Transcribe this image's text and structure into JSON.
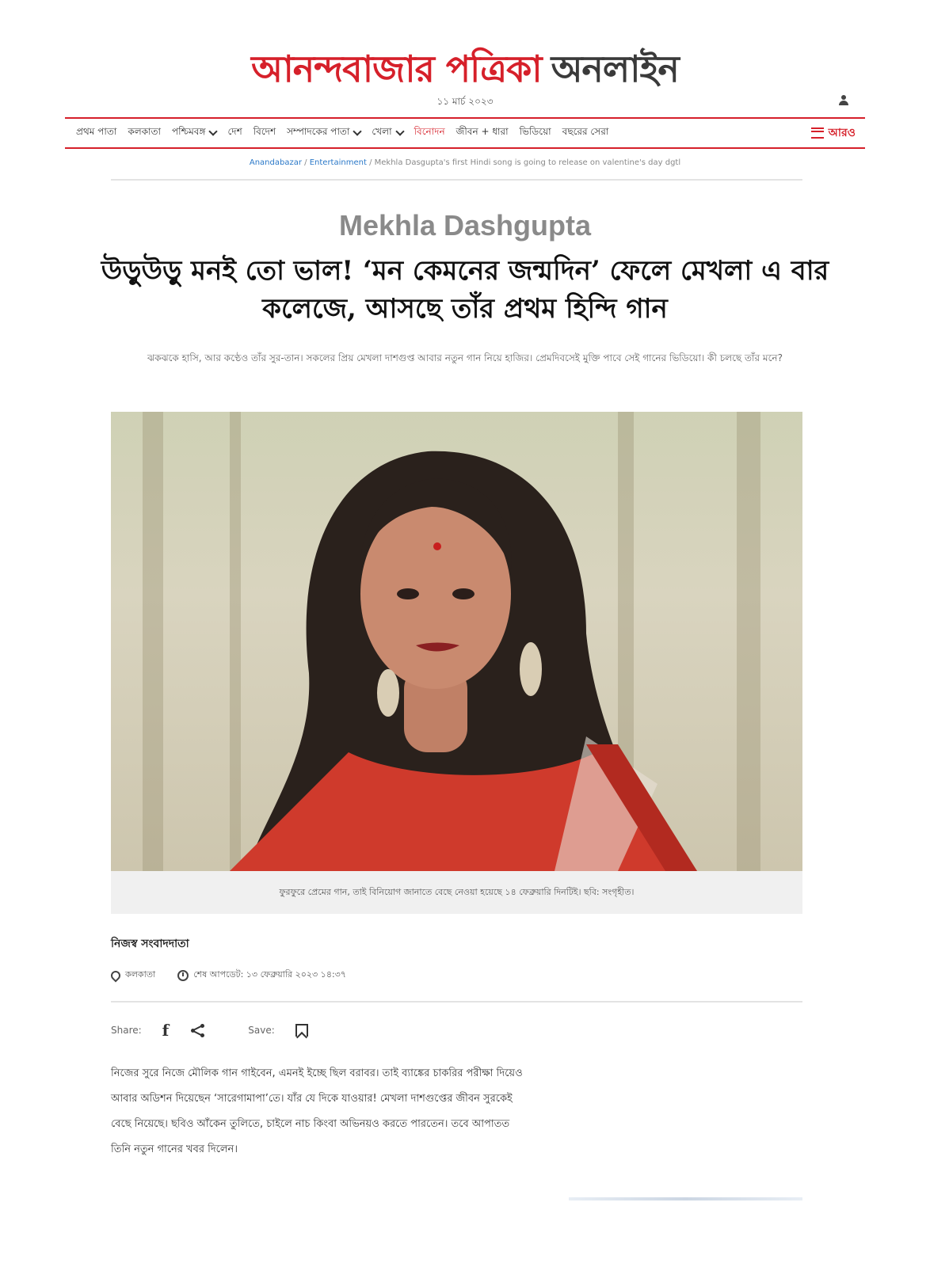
{
  "header": {
    "logo_red": "আনন্দবাজার পত্রিকা",
    "logo_dark": "অনলাইন",
    "date": "১১ মার্চ ২০২৩"
  },
  "nav": {
    "items": [
      {
        "label": "প্রথম পাতা",
        "dropdown": false
      },
      {
        "label": "কলকাতা",
        "dropdown": false
      },
      {
        "label": "পশ্চিমবঙ্গ",
        "dropdown": true
      },
      {
        "label": "দেশ",
        "dropdown": false
      },
      {
        "label": "বিদেশ",
        "dropdown": false
      },
      {
        "label": "সম্পাদকের পাতা",
        "dropdown": true
      },
      {
        "label": "খেলা",
        "dropdown": true
      },
      {
        "label": "বিনোদন",
        "dropdown": false,
        "active": true
      },
      {
        "label": "জীবন + ধারা",
        "dropdown": false
      },
      {
        "label": "ভিডিয়ো",
        "dropdown": false
      },
      {
        "label": "বছরের সেরা",
        "dropdown": false
      }
    ],
    "more_label": "আরও"
  },
  "breadcrumb": {
    "home": "Anandabazar",
    "section": "Entertainment",
    "current": "Mekhla Dasgupta's first Hindi song is going to release on valentine's day dgtl"
  },
  "article": {
    "kicker": "Mekhla Dashgupta",
    "headline": "উড়ুউড়ু মনই তো ভাল! ‘মন কেমনের জন্মদিন’ ফেলে মেখলা এ বার কলেজে, আসছে তাঁর প্রথম হিন্দি গান",
    "standfirst": "ঝকঝকে হাসি, আর কণ্ঠেও তাঁর সুর-তান। সকলের প্রিয় মেখলা দাশগুপ্ত আবার নতুন গান নিয়ে হাজির। প্রেমদিবসেই মুক্তি পাবে সেই গানের ভিডিয়ো। কী চলছে তাঁর মনে?",
    "caption": "ফুরফুরে প্রেমের গান, তাই বিনিয়োগ জানাতে বেছে নেওয়া হয়েছে ১৪ ফেব্রুয়ারি দিনটিই। ছবি: সংগৃহীত।",
    "author": "নিজস্ব সংবাদদাতা",
    "location": "কলকাতা",
    "updated": "শেষ আপডেট: ১৩ ফেব্রুয়ারি ২০২৩ ১৪:৩৭",
    "share_label": "Share:",
    "save_label": "Save:",
    "body": "নিজের সুরে নিজে মৌলিক গান গাইবেন, এমনই ইচ্ছে ছিল বরাবর। তাই ব্যাঙ্কের চাকরির পরীক্ষা দিয়েও আবার অডিশন দিয়েছেন ‘সারেগামাপা’তে। যাঁর যে দিকে যাওয়ার! মেখলা দাশগুপ্তের জীবন সুরকেই বেছে নিয়েছে। ছবিও আঁকেন তুলিতে, চাইলে নাচ কিংবা অভিনয়ও করতে পারতেন। তবে আপাতত তিনি নতুন গানের খবর দিলেন।"
  },
  "icons": {
    "user": "user-icon",
    "location": "map-pin-icon",
    "clock": "clock-icon",
    "facebook": "facebook-icon",
    "share": "share-icon",
    "bookmark": "bookmark-icon",
    "menu": "hamburger-icon"
  },
  "colors": {
    "brand_red": "#d6202a",
    "link_blue": "#2a78c8"
  }
}
